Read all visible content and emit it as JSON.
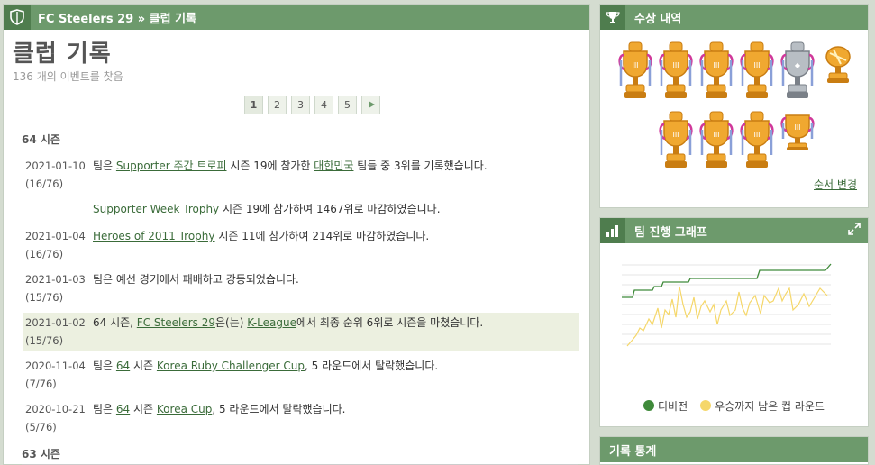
{
  "header": {
    "club_name": "FC Steelers 29",
    "separator": "»",
    "section": "클럽 기록"
  },
  "page_title": "클럽 기록",
  "event_count": "136 개의 이벤트를 찾음",
  "pager": {
    "pages": [
      "1",
      "2",
      "3",
      "4",
      "5"
    ],
    "current": "1",
    "next_icon": "play-icon"
  },
  "seasons": [
    {
      "label": "64 시즌",
      "events": [
        {
          "date": "2021-01-10",
          "count": "(16/76)",
          "parts": [
            "팀은 ",
            {
              "link": "Supporter 주간 트로피"
            },
            " 시즌 19에 참가한 ",
            {
              "link": "대한민국"
            },
            " 팀들 중 3위를 기록했습니다."
          ]
        },
        {
          "date": "",
          "count": "",
          "parts": [
            {
              "link": "Supporter Week Trophy"
            },
            " 시즌 19에 참가하여 1467위로 마감하였습니다."
          ]
        },
        {
          "date": "2021-01-04",
          "count": "(16/76)",
          "parts": [
            {
              "link": "Heroes of 2011 Trophy"
            },
            " 시즌 11에 참가하여 214위로 마감하였습니다."
          ]
        },
        {
          "date": "2021-01-03",
          "count": "(15/76)",
          "parts": [
            "팀은 예선 경기에서 패배하고 강등되었습니다."
          ]
        },
        {
          "date": "2021-01-02",
          "count": "(15/76)",
          "highlight": true,
          "parts": [
            "64 시즌, ",
            {
              "link": "FC Steelers 29"
            },
            "은(는) ",
            {
              "link": "K-League"
            },
            "에서 최종 순위 6위로 시즌을 마쳤습니다."
          ]
        },
        {
          "date": "2020-11-04",
          "count": "(7/76)",
          "parts": [
            "팀은 ",
            {
              "link": "64"
            },
            " 시즌 ",
            {
              "link": "Korea Ruby Challenger Cup"
            },
            ", 5 라운드에서 탈락했습니다."
          ]
        },
        {
          "date": "2020-10-21",
          "count": "(5/76)",
          "parts": [
            "팀은 ",
            {
              "link": "64"
            },
            " 시즌 ",
            {
              "link": "Korea Cup"
            },
            ", 5 라운드에서 탈락했습니다."
          ]
        }
      ]
    },
    {
      "label": "63 시즌",
      "events": []
    }
  ],
  "awards": {
    "title": "수상 내역",
    "reorder_label": "순서 변경",
    "trophies_row1": [
      "gold-cup",
      "gold-cup",
      "gold-cup",
      "gold-cup",
      "silver-cup",
      "gold-ball"
    ],
    "trophies_row2": [
      "gold-cup",
      "gold-cup",
      "gold-cup",
      "gold-cup-small"
    ]
  },
  "progress": {
    "title": "팀 진행 그래프",
    "legend": [
      {
        "label": "디비전",
        "color": "#3f8a3a"
      },
      {
        "label": "우승까지 남은 컵 라운드",
        "color": "#f5d76a"
      }
    ]
  },
  "stats": {
    "title": "기록 통계"
  },
  "colors": {
    "header": "#6d9a6c",
    "header_dark": "#4f7d4e",
    "link": "#3a6b39",
    "highlight": "#ecf0e0"
  }
}
